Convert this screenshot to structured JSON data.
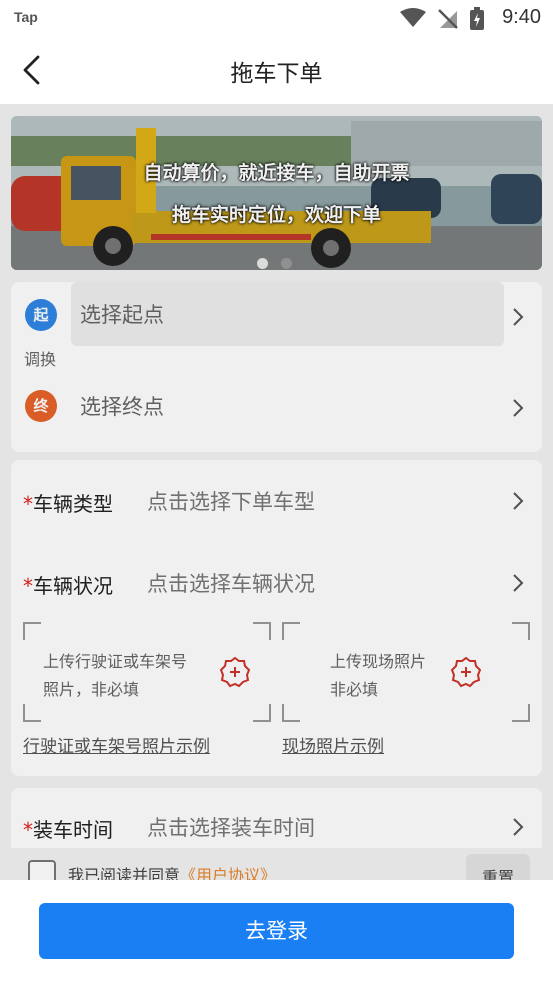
{
  "status_bar": {
    "carrier": "Tap",
    "time": "9:40"
  },
  "title_bar": {
    "title": "拖车下单"
  },
  "banner": {
    "caption_line1": "自动算价，就近接车，自助开票",
    "caption_line2": "拖车实时定位，欢迎下单",
    "page_count": 2,
    "active_page": 1
  },
  "route": {
    "start_badge": "起",
    "start_placeholder": "选择起点",
    "swap_label": "调换",
    "end_badge": "终",
    "end_placeholder": "选择终点"
  },
  "vehicle": {
    "required_mark": "*",
    "type_label": "车辆类型",
    "type_value": "点击选择下单车型",
    "condition_label": "车辆状况",
    "condition_value": "点击选择车辆状况",
    "upload_license_line1": "上传行驶证或车架号",
    "upload_license_line2": "照片，非必填",
    "upload_scene_line1": "上传现场照片",
    "upload_scene_line2": "非必填",
    "license_example_link": "行驶证或车架号照片示例",
    "scene_example_link": "现场照片示例"
  },
  "load_time": {
    "required_mark": "*",
    "label": "装车时间",
    "value": "点击选择装车时间"
  },
  "agreement": {
    "text": "我已阅读并同意",
    "link": "《用户协议》",
    "reset_label": "重置"
  },
  "footer": {
    "login_button": "去登录"
  },
  "colors": {
    "primary": "#1a7ff3",
    "start_badge": "#2f86e6",
    "end_badge": "#e8632a",
    "required": "#e02020",
    "link": "#e8862a"
  }
}
